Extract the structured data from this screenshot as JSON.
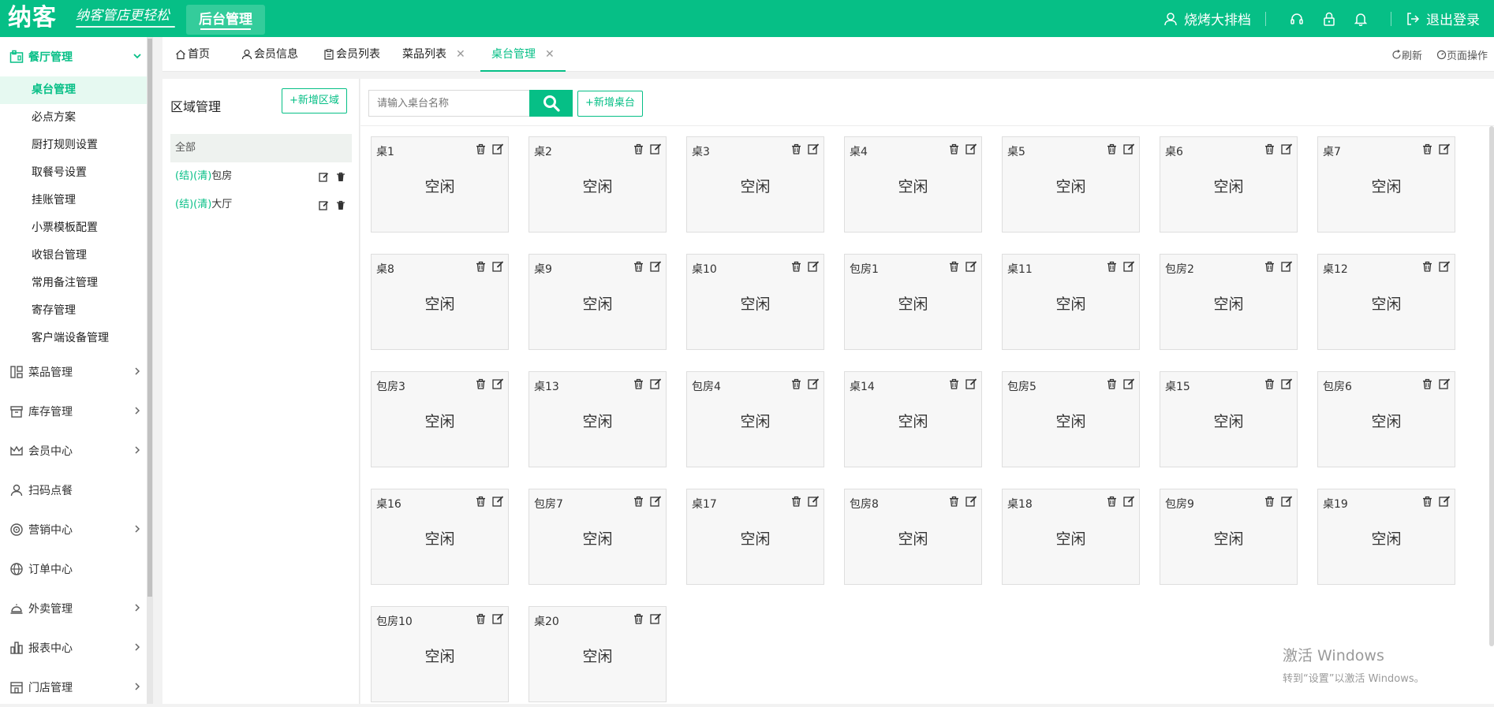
{
  "header": {
    "logo": "纳客",
    "slogan": "纳客管店更轻松",
    "nav_label": "后台管理",
    "user_name": "烧烤大排档",
    "logout_label": "退出登录"
  },
  "sidebar": {
    "groups": [
      {
        "label": "餐厅管理"
      },
      {
        "label": "菜品管理"
      },
      {
        "label": "库存管理"
      },
      {
        "label": "会员中心"
      },
      {
        "label": "扫码点餐"
      },
      {
        "label": "营销中心"
      },
      {
        "label": "订单中心"
      },
      {
        "label": "外卖管理"
      },
      {
        "label": "报表中心"
      },
      {
        "label": "门店管理"
      }
    ],
    "sub_items": [
      {
        "label": "桌台管理"
      },
      {
        "label": "必点方案"
      },
      {
        "label": "厨打规则设置"
      },
      {
        "label": "取餐号设置"
      },
      {
        "label": "挂账管理"
      },
      {
        "label": "小票模板配置"
      },
      {
        "label": "收银台管理"
      },
      {
        "label": "常用备注管理"
      },
      {
        "label": "寄存管理"
      },
      {
        "label": "客户端设备管理"
      }
    ]
  },
  "tabs": {
    "items": [
      {
        "label": "首页"
      },
      {
        "label": "会员信息"
      },
      {
        "label": "会员列表"
      },
      {
        "label": "菜品列表"
      },
      {
        "label": "桌台管理"
      }
    ],
    "refresh_label": "刷新",
    "page_ops_label": "页面操作"
  },
  "area": {
    "title": "区域管理",
    "add_label": "+新增区域",
    "items": [
      {
        "tag": "",
        "name": "全部"
      },
      {
        "tag": "(结)(清)",
        "name": "包房"
      },
      {
        "tag": "(结)(清)",
        "name": "大厅"
      }
    ]
  },
  "main": {
    "search_placeholder": "请输入桌台名称",
    "add_table_label": "+新增桌台",
    "tables": [
      {
        "name": "桌1",
        "status": "空闲"
      },
      {
        "name": "桌2",
        "status": "空闲"
      },
      {
        "name": "桌3",
        "status": "空闲"
      },
      {
        "name": "桌4",
        "status": "空闲"
      },
      {
        "name": "桌5",
        "status": "空闲"
      },
      {
        "name": "桌6",
        "status": "空闲"
      },
      {
        "name": "桌7",
        "status": "空闲"
      },
      {
        "name": "桌8",
        "status": "空闲"
      },
      {
        "name": "桌9",
        "status": "空闲"
      },
      {
        "name": "桌10",
        "status": "空闲"
      },
      {
        "name": "包房1",
        "status": "空闲"
      },
      {
        "name": "桌11",
        "status": "空闲"
      },
      {
        "name": "包房2",
        "status": "空闲"
      },
      {
        "name": "桌12",
        "status": "空闲"
      },
      {
        "name": "包房3",
        "status": "空闲"
      },
      {
        "name": "桌13",
        "status": "空闲"
      },
      {
        "name": "包房4",
        "status": "空闲"
      },
      {
        "name": "桌14",
        "status": "空闲"
      },
      {
        "name": "包房5",
        "status": "空闲"
      },
      {
        "name": "桌15",
        "status": "空闲"
      },
      {
        "name": "包房6",
        "status": "空闲"
      },
      {
        "name": "桌16",
        "status": "空闲"
      },
      {
        "name": "包房7",
        "status": "空闲"
      },
      {
        "name": "桌17",
        "status": "空闲"
      },
      {
        "name": "包房8",
        "status": "空闲"
      },
      {
        "name": "桌18",
        "status": "空闲"
      },
      {
        "name": "包房9",
        "status": "空闲"
      },
      {
        "name": "桌19",
        "status": "空闲"
      },
      {
        "name": "包房10",
        "status": "空闲"
      },
      {
        "name": "桌20",
        "status": "空闲"
      }
    ]
  },
  "watermark": {
    "line1": "激活 Windows",
    "line2": "转到“设置”以激活 Windows。"
  },
  "colors": {
    "brand": "#06bf86",
    "active_bg": "#e6f9f1"
  }
}
